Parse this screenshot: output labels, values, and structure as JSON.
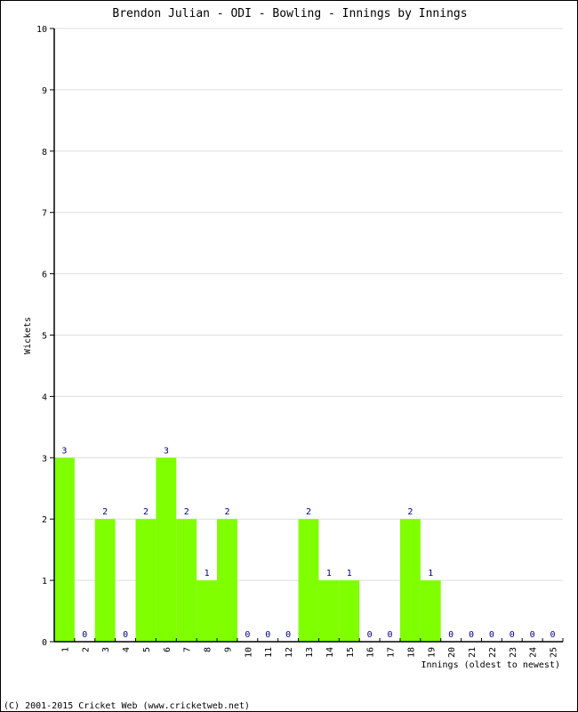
{
  "chart_data": {
    "type": "bar",
    "title": "Brendon Julian - ODI - Bowling - Innings by Innings",
    "xlabel": "Innings (oldest to newest)",
    "ylabel": "Wickets",
    "ylim": [
      0,
      10
    ],
    "yticks": [
      "0",
      "1",
      "2",
      "3",
      "4",
      "5",
      "6",
      "7",
      "8",
      "9",
      "10"
    ],
    "grid": true,
    "categories": [
      "1",
      "2",
      "3",
      "4",
      "5",
      "6",
      "7",
      "8",
      "9",
      "10",
      "11",
      "12",
      "13",
      "14",
      "15",
      "16",
      "17",
      "18",
      "19",
      "20",
      "21",
      "22",
      "23",
      "24",
      "25"
    ],
    "values": [
      3,
      0,
      2,
      0,
      2,
      3,
      2,
      1,
      2,
      0,
      0,
      0,
      2,
      1,
      1,
      0,
      0,
      2,
      1,
      0,
      0,
      0,
      0,
      0,
      0
    ],
    "value_labels": [
      "3",
      "0",
      "2",
      "0",
      "2",
      "3",
      "2",
      "1",
      "2",
      "0",
      "0",
      "0",
      "2",
      "1",
      "1",
      "0",
      "0",
      "2",
      "1",
      "0",
      "0",
      "0",
      "0",
      "0",
      "0"
    ],
    "colors": {
      "bar": "#80ff00",
      "label": "#000080",
      "grid": "#dddddd",
      "axis": "#000000"
    }
  },
  "footer": {
    "copyright": "(C) 2001-2015 Cricket Web (www.cricketweb.net)"
  }
}
